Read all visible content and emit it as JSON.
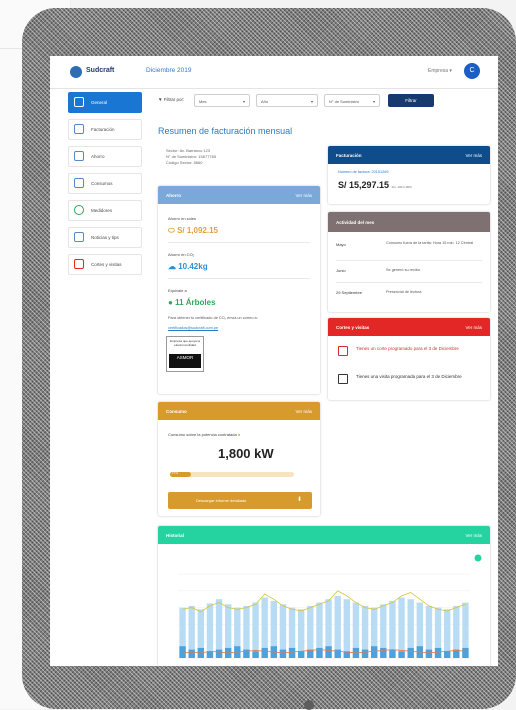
{
  "header": {
    "app_name": "Sudcraft",
    "period": "Diciembre 2019",
    "company": "Empresa",
    "avatar_letter": "C"
  },
  "sidebar": {
    "items": [
      {
        "label": "General",
        "icon": "home-icon",
        "active": true
      },
      {
        "label": "Facturación",
        "icon": "invoice-icon",
        "active": false
      },
      {
        "label": "Ahorro",
        "icon": "piggy-bank-icon",
        "active": false
      },
      {
        "label": "Consumos",
        "icon": "bar-chart-icon",
        "active": false
      },
      {
        "label": "Medidores",
        "icon": "meter-icon",
        "active": false
      },
      {
        "label": "Noticias y tips",
        "icon": "news-icon",
        "active": false
      },
      {
        "label": "Cortes y visitas",
        "icon": "calendar-icon",
        "active": false
      }
    ]
  },
  "filter": {
    "label": "Filtrar por:",
    "mes": "Mes",
    "anio": "Año",
    "suministro": "N° de Suministro",
    "button": "Filtrar"
  },
  "page_title": "Resumen de facturación mensual",
  "client": {
    "line1": "Sector: Av. Barranco 123",
    "line2": "N° de Suministro: 15677765",
    "line3": "Código Sector: 5660"
  },
  "ahorro": {
    "title": "Ahorro",
    "link": "Ver más",
    "monto_label": "Ahorro en soles",
    "monto_value": "S/ 1,092.15",
    "co2_label": "Ahorro en CO₂",
    "co2_value": "10.42kg",
    "equiv_label": "Equivale a",
    "equiv_value": "11 Árboles",
    "cert_text": "Para obtener tu certificado de CO₂ envía un correo a:",
    "cert_email": "certificados@sudcraft.com.pe",
    "badge_top": "Empresa que apoya la electromovilidad",
    "badge_bottom": "ASMOR"
  },
  "consumo": {
    "title": "Consumo",
    "link": "Ver más",
    "label": "Consumo sobre la potencia contratada",
    "value": "1,800 kW",
    "progress": 0.17,
    "progress_label": "17%",
    "download": "Descargar informe detallado"
  },
  "facturacion": {
    "title": "Facturación",
    "link": "Ver más",
    "recibo_label": "Número de factura: 20151269",
    "amount": "S/ 15,297.15",
    "amount_unit": "Fin. 100 ó 00%"
  },
  "actividad": {
    "title": "Actividad del mes",
    "rows": [
      {
        "label": "Mayo",
        "desc": "Consumo fuera de la tarifa: Hora 15 min. 12 Central"
      },
      {
        "label": "Junio",
        "desc": "Se generó su recibo"
      },
      {
        "label": "29 Septiembre",
        "desc": "Presencial de lectura"
      }
    ]
  },
  "cortes": {
    "title": "Cortes y visitas",
    "link": "Ver más",
    "item1": "Tienes un corte programado para el 3 de Diciembre",
    "item2": "Tienes una visita programada para el 3 de Diciembre"
  },
  "historial": {
    "title": "Historial",
    "link": "Ver más"
  },
  "colors": {
    "primary": "#1976d2",
    "dark_blue": "#163a6e",
    "ahorro_header": "#7aa8d8",
    "consumo_header": "#d69a2d",
    "facturacion_header": "#0f4c8a",
    "actividad_header": "#7f7171",
    "cortes_header": "#e32626",
    "historial_header": "#25d3a0"
  },
  "chart_data": {
    "type": "bar",
    "series": [
      {
        "type": "bar",
        "values": [
          60,
          62,
          58,
          65,
          70,
          64,
          60,
          62,
          66,
          72,
          68,
          64,
          60,
          58,
          62,
          66,
          70,
          74,
          70,
          66,
          62,
          60,
          64,
          68,
          72,
          70,
          66,
          62,
          60,
          58,
          62,
          66
        ]
      },
      {
        "type": "bar",
        "values": [
          14,
          10,
          12,
          8,
          10,
          12,
          14,
          10,
          8,
          12,
          14,
          10,
          12,
          8,
          10,
          12,
          14,
          10,
          8,
          12,
          10,
          14,
          12,
          10,
          8,
          12,
          14,
          10,
          12,
          8,
          10,
          12
        ]
      },
      {
        "type": "line",
        "values": [
          58,
          60,
          55,
          62,
          66,
          60,
          58,
          60,
          64,
          76,
          70,
          62,
          58,
          56,
          60,
          64,
          68,
          80,
          74,
          66,
          60,
          58,
          62,
          66,
          74,
          78,
          70,
          62,
          58,
          56,
          60,
          64
        ]
      },
      {
        "type": "line",
        "values": [
          6,
          7,
          6,
          8,
          7,
          6,
          7,
          8,
          9,
          8,
          7,
          6,
          7,
          8,
          9,
          10,
          9,
          8,
          7,
          6,
          7,
          8,
          9,
          10,
          9,
          8,
          7,
          6,
          7,
          8,
          9,
          8
        ]
      }
    ],
    "ylim": [
      0,
      100
    ]
  }
}
